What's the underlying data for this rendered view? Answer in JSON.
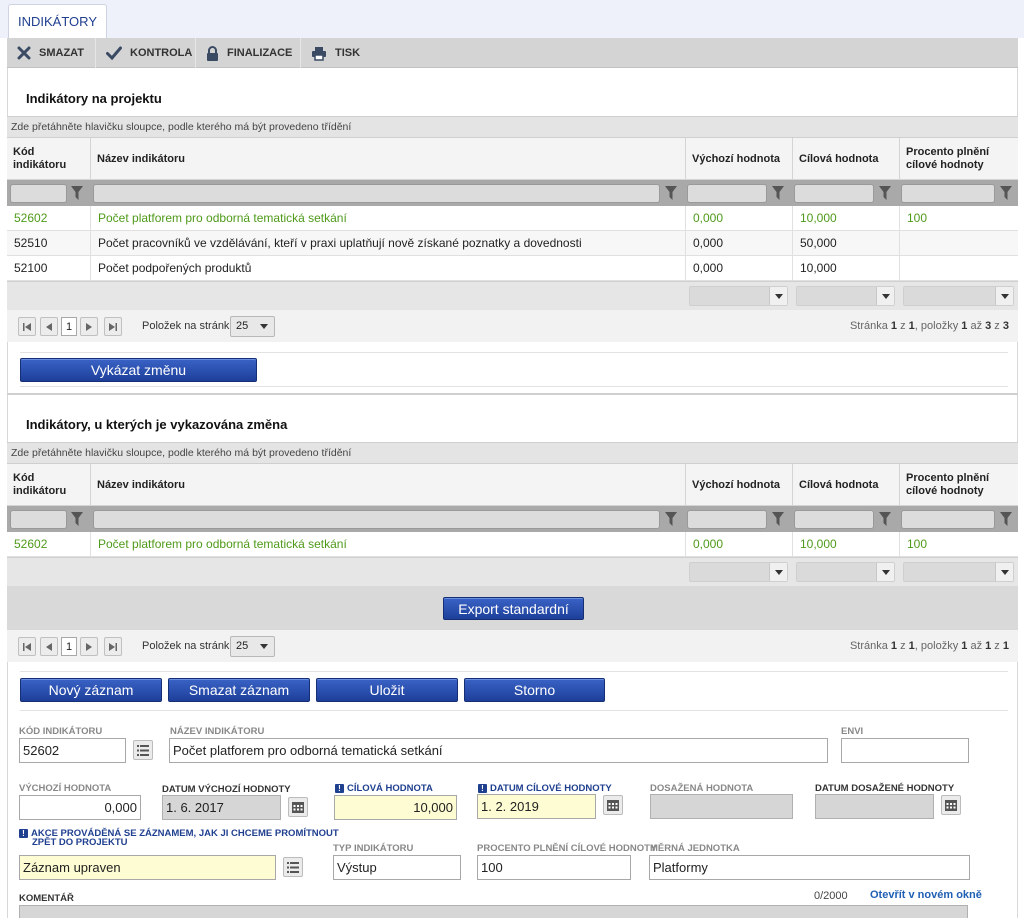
{
  "tab": {
    "label": "INDIKÁTORY"
  },
  "toolbar": {
    "delete_label": "SMAZAT",
    "check_label": "KONTROLA",
    "finalize_label": "FINALIZACE",
    "print_label": "TISK"
  },
  "grid1": {
    "title": "Indikátory na projektu",
    "hint": "Zde přetáhněte hlavičku sloupce, podle kterého má být provedeno třídění",
    "columns": [
      "Kód indikátoru",
      "Název indikátoru",
      "Výchozí hodnota",
      "Cílová hodnota",
      "Procento plnění cílové hodnoty"
    ],
    "rows": [
      {
        "code": "52602",
        "name": "Počet platforem pro odborná tematická setkání",
        "start": "0,000",
        "target": "10,000",
        "percent": "100"
      },
      {
        "code": "52510",
        "name": "Počet pracovníků ve vzdělávání, kteří v praxi uplatňují nově získané poznatky a dovednosti",
        "start": "0,000",
        "target": "50,000",
        "percent": ""
      },
      {
        "code": "52100",
        "name": "Počet podpořených produktů",
        "start": "0,000",
        "target": "10,000",
        "percent": ""
      }
    ],
    "pager": {
      "page": "1",
      "page_size_label": "Položek na stránku",
      "page_size": "25",
      "info_prefix": "Stránka ",
      "info_page": "1",
      "info_z1": " z ",
      "info_pages": "1",
      "info_mid": ", položky ",
      "info_from": "1",
      "info_az": " až ",
      "info_to": "3",
      "info_z2": " z ",
      "info_total": "3"
    }
  },
  "report_change_label": "Vykázat změnu",
  "grid2": {
    "title": "Indikátory, u kterých je vykazována změna",
    "hint": "Zde přetáhněte hlavičku sloupce, podle kterého má být provedeno třídění",
    "columns": [
      "Kód indikátoru",
      "Název indikátoru",
      "Výchozí hodnota",
      "Cílová hodnota",
      "Procento plnění cílové hodnoty"
    ],
    "rows": [
      {
        "code": "52602",
        "name": "Počet platforem pro odborná tematická setkání",
        "start": "0,000",
        "target": "10,000",
        "percent": "100"
      }
    ],
    "export_label": "Export standardní",
    "pager": {
      "page": "1",
      "page_size_label": "Položek na stránku",
      "page_size": "25",
      "info_prefix": "Stránka ",
      "info_page": "1",
      "info_z1": " z ",
      "info_pages": "1",
      "info_mid": ", položky ",
      "info_from": "1",
      "info_az": " až ",
      "info_to": "1",
      "info_z2": " z ",
      "info_total": "1"
    }
  },
  "actions": {
    "new": "Nový záznam",
    "delete": "Smazat záznam",
    "save": "Uložit",
    "cancel": "Storno"
  },
  "form": {
    "code_label": "KÓD INDIKÁTORU",
    "code_value": "52602",
    "name_label": "NÁZEV INDIKÁTORU",
    "name_value": "Počet platforem pro odborná tematická setkání",
    "envi_label": "ENVI",
    "envi_value": "",
    "start_label": "VÝCHOZÍ HODNOTA",
    "start_value": "0,000",
    "start_date_label": "DATUM VÝCHOZÍ HODNOTY",
    "start_date_value": "1. 6. 2017",
    "target_label": "CÍLOVÁ HODNOTA",
    "target_value": "10,000",
    "target_date_label": "DATUM CÍLOVÉ HODNOTY",
    "target_date_value": "1. 2. 2019",
    "achieved_label": "DOSAŽENÁ HODNOTA",
    "achieved_value": "",
    "achieved_date_label": "DATUM DOSAŽENÉ HODNOTY",
    "achieved_date_value": "",
    "action_label_1": "AKCE PROVÁDĚNÁ SE ZÁZNAMEM, JAK JI CHCEME PROMÍTNOUT",
    "action_label_2": "ZPĚT DO PROJEKTU",
    "action_value": "Záznam upraven",
    "type_label": "TYP INDIKÁTORU",
    "type_value": "Výstup",
    "percent_label": "PROCENTO PLNĚNÍ CÍLOVÉ HODNOTY",
    "percent_value": "100",
    "unit_label": "MĚRNÁ JEDNOTKA",
    "unit_value": "Platformy",
    "comment_label": "KOMENTÁŘ",
    "comment_count": "0/2000",
    "open_new_window": "Otevřít v novém okně"
  },
  "colors": {
    "accent": "#1f3f8f",
    "green": "#4f9a1a",
    "required_bg": "#fefcd2"
  }
}
